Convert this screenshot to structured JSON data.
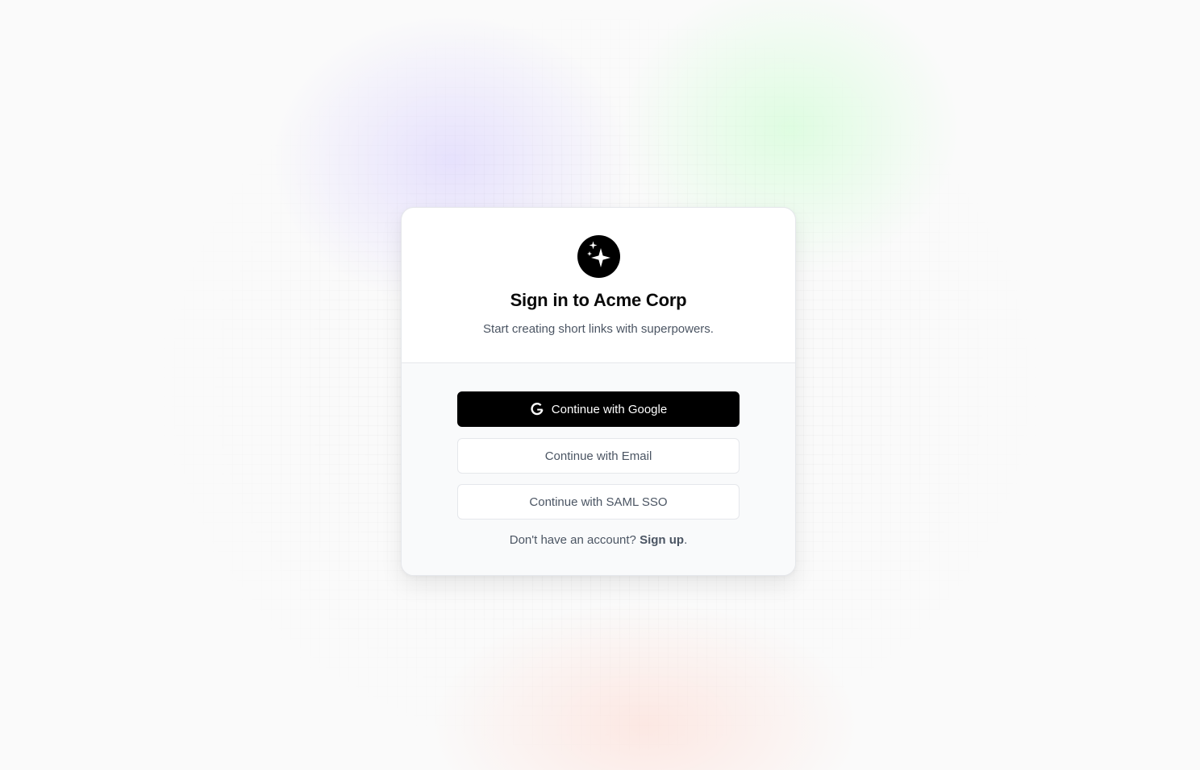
{
  "page": {
    "title": "Sign in to Acme Corp",
    "subtitle": "Start creating short links with superpowers."
  },
  "logo": {
    "icon": "sparkles-icon"
  },
  "buttons": {
    "google": {
      "label": "Continue with Google",
      "icon": "google-icon"
    },
    "email": {
      "label": "Continue with Email"
    },
    "saml": {
      "label": "Continue with SAML SSO"
    }
  },
  "signup": {
    "prompt": "Don't have an account?",
    "link_label": "Sign up",
    "suffix": "."
  },
  "colors": {
    "primary_button_bg": "#000000",
    "primary_button_text": "#ffffff",
    "text_muted": "#4b5563"
  }
}
